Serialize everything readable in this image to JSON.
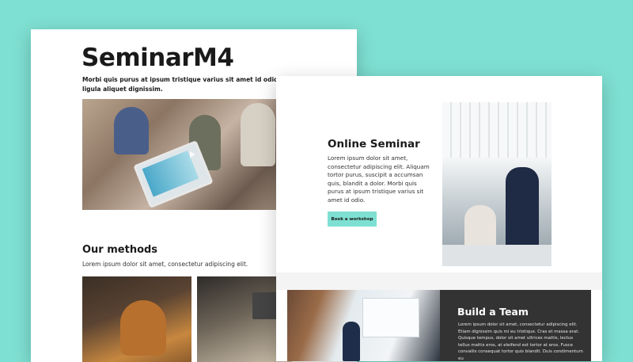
{
  "back_page": {
    "title": "SeminarM4",
    "lead": "Morbi quis purus at ipsum tristique varius sit amet id odio. Ut tincidunt ligula aliquet dignissim.",
    "methods_heading": "Our methods",
    "methods_text": "Lorem ipsum dolor sit amet, consectetur adipiscing elit."
  },
  "front_page": {
    "heading": "Online Seminar",
    "body": "Lorem ipsum dolor sit amet, consectetur adipiscing elit. Aliquam tortor purus, suscipit a accumsan quis, blandit a dolor. Morbi quis purus at ipsum tristique varius sit amet id odio.",
    "button_label": "Book a workshop",
    "team_heading": "Build a Team",
    "team_text": "Lorem ipsum dolor sit amet, consectetur adipiscing elit. Etiam dignissim quis mi eu tristique. Cras et massa erat. Quisque tempus, dolor sit amet ultrices mattis, lectus tellus mattis eros, at eleifend est tortor at eros. Fusce convallis consequat tortor quis blandit. Duis condimentum eu"
  },
  "colors": {
    "background": "#7ee0d2",
    "accent": "#7ee0d2",
    "dark_panel": "#333333"
  }
}
